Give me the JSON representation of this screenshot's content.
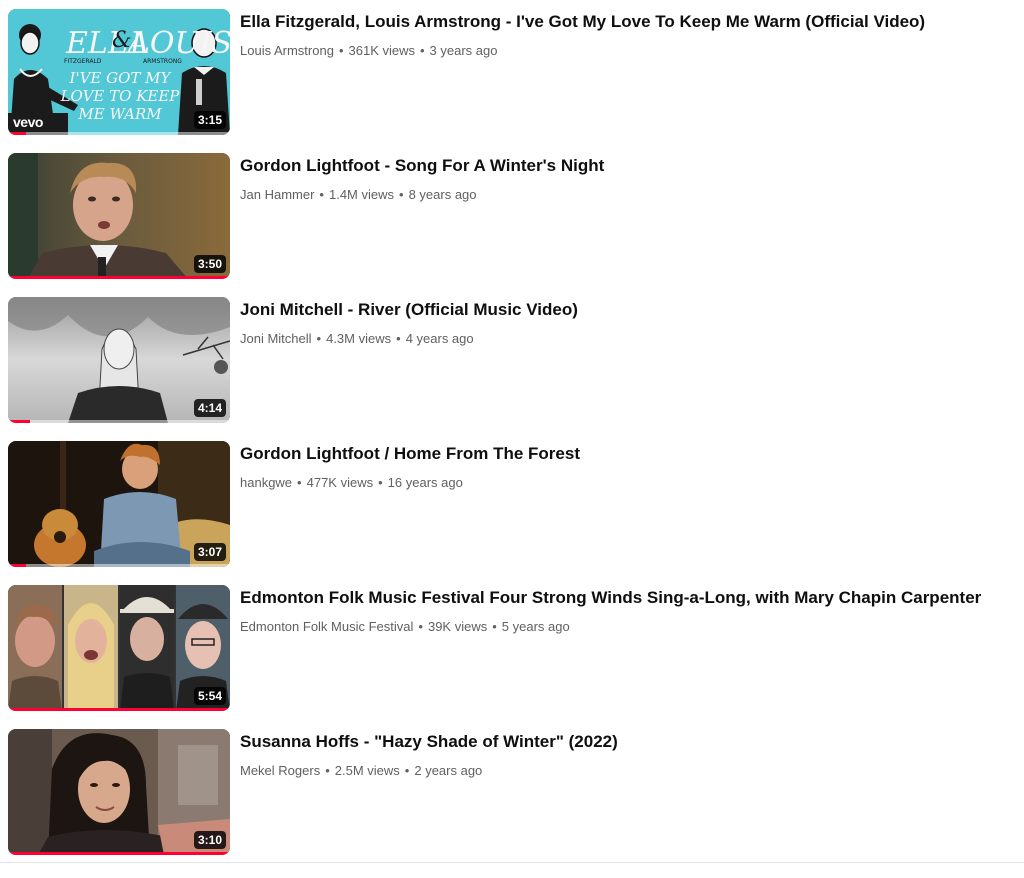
{
  "videos": [
    {
      "title": "Ella Fitzgerald, Louis Armstrong - I've Got My Love To Keep Me Warm (Official Video)",
      "channel": "Louis Armstrong",
      "views": "361K views",
      "age": "3 years ago",
      "duration": "3:15",
      "badge": "vevo",
      "thumb_text": {
        "name_left": "ELLA",
        "amp": "&",
        "name_right": "LOUIS",
        "surname_left": "FITZGERALD",
        "surname_right": "ARMSTRONG",
        "song": [
          "I'VE GOT MY",
          "LOVE TO KEEP",
          "ME WARM"
        ]
      },
      "progress": 0.08
    },
    {
      "title": "Gordon Lightfoot - Song For A Winter's Night",
      "channel": "Jan Hammer",
      "views": "1.4M views",
      "age": "8 years ago",
      "duration": "3:50",
      "progress": 1.0
    },
    {
      "title": "Joni Mitchell - River (Official Music Video)",
      "channel": "Joni Mitchell",
      "views": "4.3M views",
      "age": "4 years ago",
      "duration": "4:14",
      "progress": 0.1
    },
    {
      "title": "Gordon Lightfoot / Home From The Forest",
      "channel": "hankgwe",
      "views": "477K views",
      "age": "16 years ago",
      "duration": "3:07",
      "progress": 0.08
    },
    {
      "title": "Edmonton Folk Music Festival Four Strong Winds Sing-a-Long, with Mary Chapin Carpenter",
      "channel": "Edmonton Folk Music Festival",
      "views": "39K views",
      "age": "5 years ago",
      "duration": "5:54",
      "progress": 1.0
    },
    {
      "title": "Susanna Hoffs - \"Hazy Shade of Winter\" (2022)",
      "channel": "Mekel Rogers",
      "views": "2.5M views",
      "age": "2 years ago",
      "duration": "3:10",
      "progress": 1.0
    }
  ],
  "colors": {
    "progress": "#ff0033",
    "title": "#0f0f0f",
    "byline": "#606060",
    "ella_bg": "#52c7d6"
  }
}
